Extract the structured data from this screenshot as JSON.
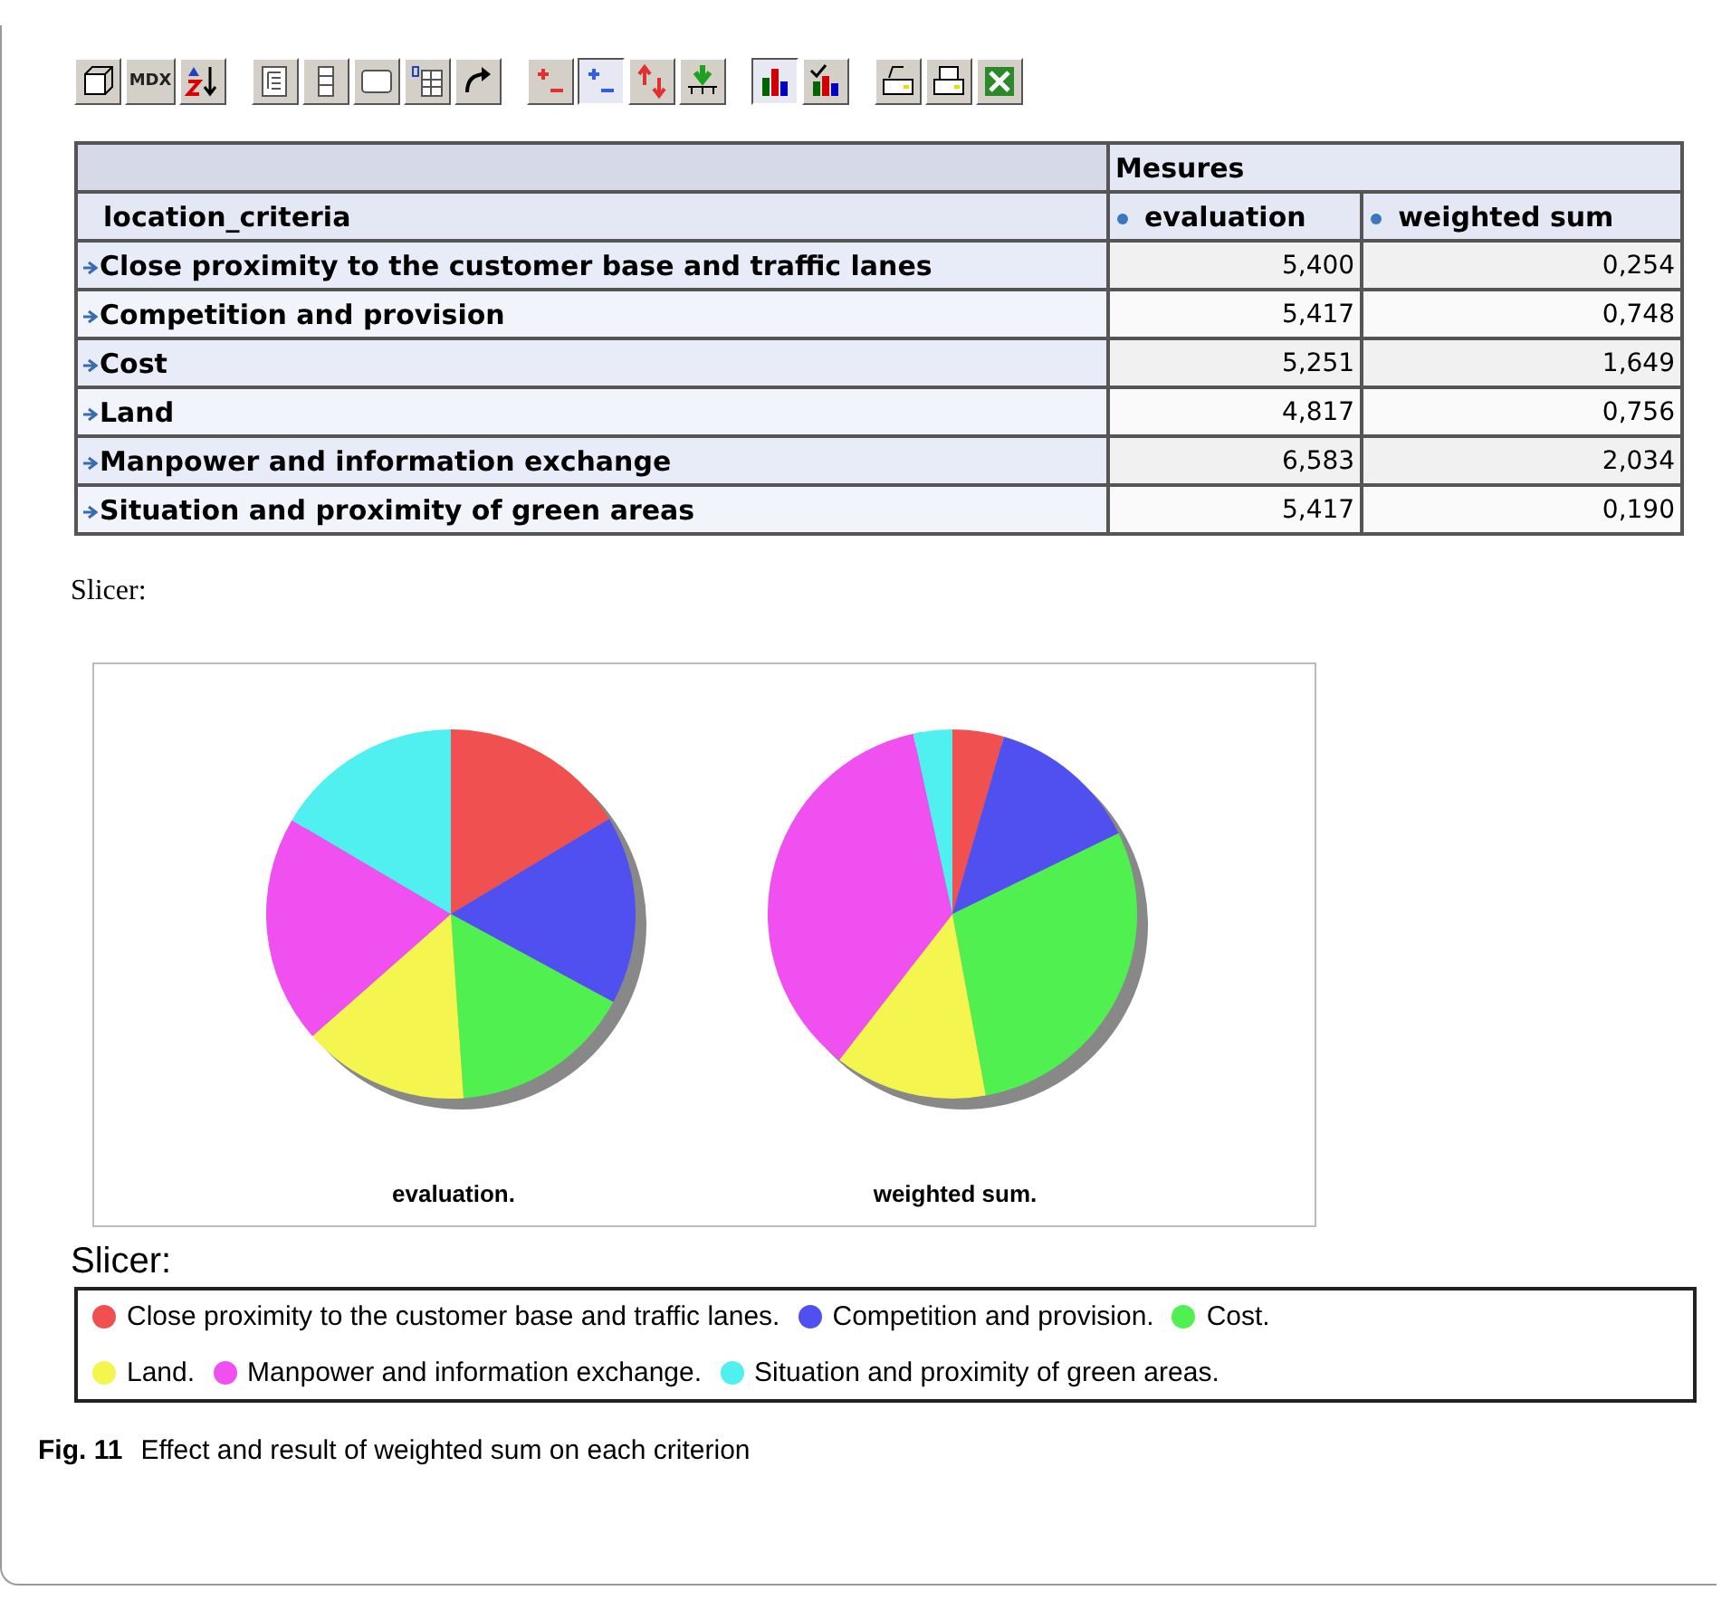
{
  "toolbar": {
    "groups": [
      {
        "buttons": [
          {
            "kind": "cube",
            "pressed": false
          },
          {
            "kind": "text",
            "label": "MDX",
            "pressed": false
          },
          {
            "kind": "sort",
            "pressed": false
          }
        ]
      },
      {
        "buttons": [
          {
            "kind": "tree",
            "pressed": false
          },
          {
            "kind": "rows",
            "pressed": false
          },
          {
            "kind": "frame",
            "pressed": false
          },
          {
            "kind": "zero-grid",
            "pressed": false
          },
          {
            "kind": "swap",
            "pressed": false
          }
        ]
      },
      {
        "buttons": [
          {
            "kind": "plus-minus",
            "pressed": false
          },
          {
            "kind": "plus-minus-blue",
            "pressed": true
          },
          {
            "kind": "arrows",
            "pressed": false
          },
          {
            "kind": "drill",
            "pressed": false
          }
        ]
      },
      {
        "buttons": [
          {
            "kind": "chart",
            "pressed": true
          },
          {
            "kind": "chart-edit",
            "pressed": false
          }
        ]
      },
      {
        "buttons": [
          {
            "kind": "print-edit",
            "pressed": false
          },
          {
            "kind": "print",
            "pressed": false
          },
          {
            "kind": "excel",
            "pressed": false
          }
        ]
      }
    ]
  },
  "table": {
    "group_header": "Mesures",
    "row_header": "location_criteria",
    "columns": [
      "evaluation",
      "weighted sum"
    ],
    "rows": [
      {
        "label": "Close proximity to the customer base and traffic lanes",
        "values": [
          "5,400",
          "0,254"
        ]
      },
      {
        "label": "Competition and provision",
        "values": [
          "5,417",
          "0,748"
        ]
      },
      {
        "label": "Cost",
        "values": [
          "5,251",
          "1,649"
        ]
      },
      {
        "label": "Land",
        "values": [
          "4,817",
          "0,756"
        ]
      },
      {
        "label": "Manpower and information exchange",
        "values": [
          "6,583",
          "2,034"
        ]
      },
      {
        "label": "Situation and proximity of green areas",
        "values": [
          "5,417",
          "0,190"
        ]
      }
    ]
  },
  "slicer_label": "Slicer:",
  "charts": [
    {
      "label": "evaluation.",
      "chart_data": {
        "type": "pie",
        "values": [
          16.4,
          16.5,
          16.0,
          14.6,
          20.0,
          16.5
        ]
      }
    },
    {
      "label": "weighted sum.",
      "chart_data": {
        "type": "pie",
        "values": [
          4.5,
          13.3,
          29.3,
          13.4,
          36.1,
          3.4
        ]
      }
    }
  ],
  "legend": {
    "title": "Slicer:",
    "items": [
      {
        "label": "Close proximity to the customer base and traffic lanes.",
        "color": "#f05050"
      },
      {
        "label": "Competition and provision.",
        "color": "#5050f0"
      },
      {
        "label": "Cost.",
        "color": "#50f050"
      },
      {
        "label": "Land.",
        "color": "#f5f550"
      },
      {
        "label": "Manpower and information exchange.",
        "color": "#f050f0"
      },
      {
        "label": "Situation and proximity of green areas.",
        "color": "#50f0f0"
      }
    ]
  },
  "caption": {
    "number": "Fig. 11",
    "text": "Effect and result of weighted sum on each criterion"
  }
}
